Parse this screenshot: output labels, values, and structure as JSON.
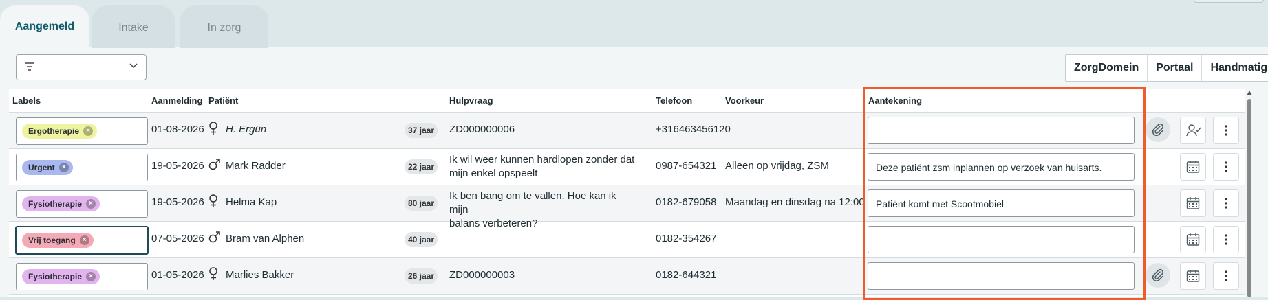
{
  "tabs": [
    {
      "label": "Aangemeld",
      "active": true
    },
    {
      "label": "Intake",
      "active": false
    },
    {
      "label": "In zorg",
      "active": false
    }
  ],
  "filter": {
    "icon": "filter-icon",
    "value": ""
  },
  "sources": {
    "zorgdomein": "ZorgDomein",
    "portaal": "Portaal",
    "handmatig": "Handmatig"
  },
  "columns": {
    "labels": "Labels",
    "aanmelding": "Aanmelding",
    "patient": "Patiënt",
    "hulpvraag": "Hulpvraag",
    "telefoon": "Telefoon",
    "voorkeur": "Voorkeur",
    "aantekening": "Aantekening"
  },
  "rows": [
    {
      "label": "Ergotherapie",
      "label_color": "#eef3a0",
      "date": "01-08-2026",
      "gender": "female",
      "name": "H. Ergün",
      "name_italic": true,
      "age": "37 jaar",
      "hulpvraag_1": "ZD000000006",
      "hulpvraag_2": "",
      "telefoon": "+316463456120",
      "voorkeur": "",
      "aantekening": "",
      "attachment": true,
      "action": "assign-user-icon"
    },
    {
      "label": "Urgent",
      "label_color": "#a9b8ef",
      "date": "19-05-2026",
      "gender": "male",
      "name": "Mark Radder",
      "name_italic": false,
      "age": "22 jaar",
      "hulpvraag_1": "Ik wil weer kunnen hardlopen zonder dat",
      "hulpvraag_2": "mijn enkel opspeelt",
      "telefoon": "0987-654321",
      "voorkeur": "Alleen op vrijdag, ZSM",
      "aantekening": "Deze patiënt zsm inplannen op verzoek van huisarts.",
      "attachment": false,
      "action": "calendar-icon"
    },
    {
      "label": "Fysiotherapie",
      "label_color": "#e2b4ee",
      "date": "19-05-2026",
      "gender": "female",
      "name": "Helma Kap",
      "name_italic": false,
      "age": "80 jaar",
      "hulpvraag_1": "Ik ben bang om te vallen. Hoe kan ik mijn",
      "hulpvraag_2": "balans verbeteren?",
      "telefoon": "0182-679058",
      "voorkeur": "Maandag en dinsdag na 12:00",
      "aantekening": "Patiënt komt met Scootmobiel",
      "attachment": false,
      "action": "calendar-icon"
    },
    {
      "label": "Vrij toegang",
      "label_color": "#f3a9b6",
      "date": "07-05-2026",
      "gender": "male",
      "name": "Bram van Alphen",
      "name_italic": false,
      "age": "40 jaar",
      "hulpvraag_1": "",
      "hulpvraag_2": "",
      "telefoon": "0182-354267",
      "voorkeur": "",
      "aantekening": "",
      "attachment": false,
      "action": "calendar-icon"
    },
    {
      "label": "Fysiotherapie",
      "label_color": "#e2b4ee",
      "date": "01-05-2026",
      "gender": "female",
      "name": "Marlies Bakker",
      "name_italic": false,
      "age": "26 jaar",
      "hulpvraag_1": "ZD000000003",
      "hulpvraag_2": "",
      "telefoon": "0182-644321",
      "voorkeur": "",
      "aantekening": "",
      "attachment": true,
      "action": "calendar-icon"
    }
  ]
}
